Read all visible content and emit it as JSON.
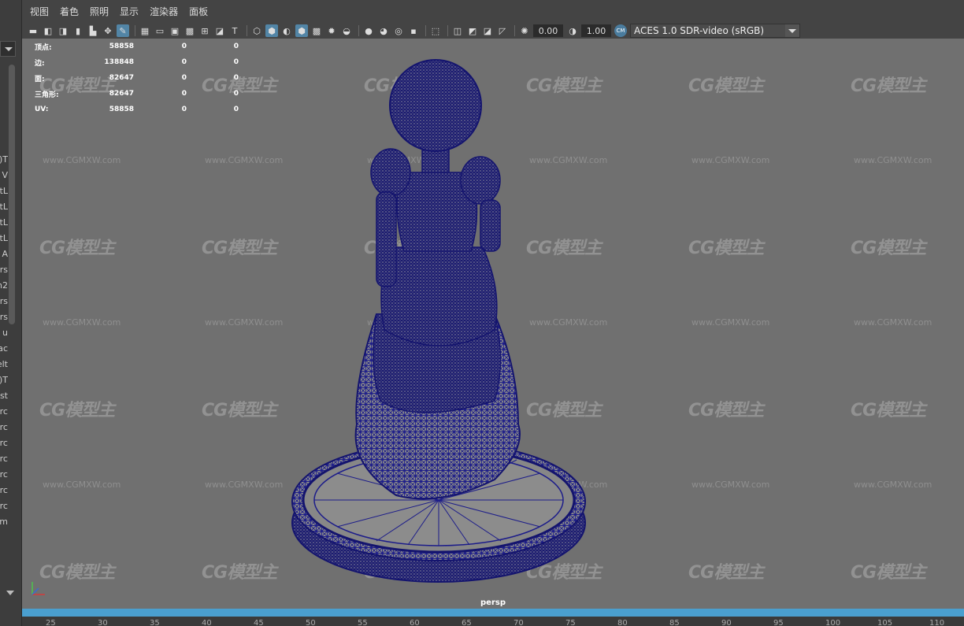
{
  "menu": [
    "视图",
    "着色",
    "照明",
    "显示",
    "渲染器",
    "面板"
  ],
  "toolbar": {
    "exposure_value": "0.00",
    "gamma_value": "1.00",
    "cm_badge": "CM",
    "color_space": "ACES 1.0 SDR-video (sRGB)",
    "icons": [
      "camera-icon",
      "camera-attr-icon",
      "bookmark-camera-icon",
      "bookmark-icon",
      "image-plane-icon",
      "2d-pan-icon",
      "grease-pencil-icon",
      "grid-icon",
      "film-gate-icon",
      "resolution-gate-icon",
      "gate-mask-icon",
      "field-chart-icon",
      "safe-action-icon",
      "safe-title-icon",
      "wireframe-icon",
      "smooth-shade-icon",
      "shaded-wireframe-icon",
      "wireframe-on-shaded-icon",
      "textured-icon",
      "use-all-lights-icon",
      "shadows-icon",
      "screen-space-ao-icon",
      "motion-blur-icon",
      "anti-aliasing-icon",
      "depth-of-field-icon",
      "isolate-select-icon",
      "xray-icon",
      "xray-active-icon",
      "xray-joints-icon",
      "backface-culling-icon",
      "exposure-icon",
      "gamma-icon"
    ]
  },
  "hud": {
    "rows": [
      {
        "label": "顶点:",
        "v1": "58858",
        "v2": "0",
        "v3": "0"
      },
      {
        "label": "边:",
        "v1": "138848",
        "v2": "0",
        "v3": "0"
      },
      {
        "label": "面:",
        "v1": "82647",
        "v2": "0",
        "v3": "0"
      },
      {
        "label": "三角形:",
        "v1": "82647",
        "v2": "0",
        "v3": "0"
      },
      {
        "label": "UV:",
        "v1": "58858",
        "v2": "0",
        "v3": "0"
      }
    ]
  },
  "watermark": {
    "logo": "CG模型主",
    "url": "www.CGMXW.com"
  },
  "viewport": {
    "camera": "persp",
    "wire_color": "#1d1d8a",
    "bg_color": "#707070"
  },
  "outliner_fragments": [
    "T(",
    "V",
    "tL",
    "tL",
    "tL",
    "tL",
    "A",
    "rs",
    "n2",
    "rs",
    "rs",
    "u",
    "ac",
    "elt",
    "T(",
    "st",
    "rc",
    "rc",
    "rc",
    "rc",
    "rc",
    "rc",
    "rc",
    "m"
  ],
  "ruler": [
    "25",
    "30",
    "35",
    "40",
    "45",
    "50",
    "55",
    "60",
    "65",
    "70",
    "75",
    "80",
    "85",
    "90",
    "95",
    "100",
    "105",
    "110"
  ]
}
